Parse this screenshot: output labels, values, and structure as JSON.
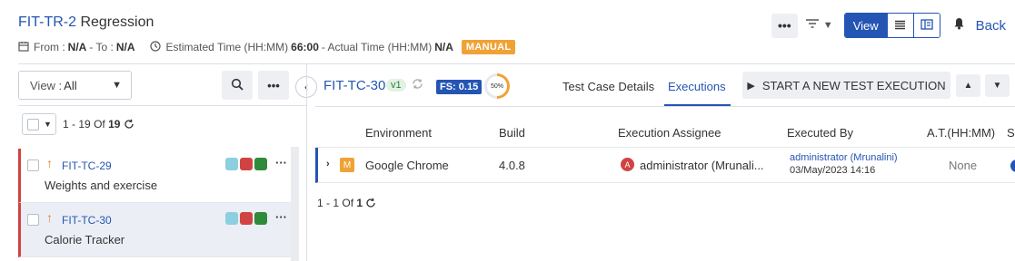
{
  "header": {
    "key": "FIT-TR-2",
    "title": "Regression",
    "from_label": "From :",
    "from_value": "N/A",
    "to_label": "- To :",
    "to_value": "N/A",
    "estimated_label": "Estimated Time (HH:MM)",
    "estimated_value": "66:00",
    "actual_label": "- Actual Time (HH:MM)",
    "actual_value": "N/A",
    "type_badge": "MANUAL",
    "view_label": "View",
    "back_label": "Back"
  },
  "left_panel": {
    "view_select_label": "View :",
    "view_select_value": "All",
    "pager": {
      "from": "1",
      "dash": "-",
      "to": "19",
      "of": "Of",
      "total": "19"
    },
    "test_cases": [
      {
        "id": "FIT-TC-29",
        "name": "Weights and exercise",
        "statuses": [
          "#8ccfe0",
          "#d14343",
          "#2e8b3a"
        ],
        "selected": false
      },
      {
        "id": "FIT-TC-30",
        "name": "Calorie Tracker",
        "statuses": [
          "#8ccfe0",
          "#d14343",
          "#2e8b3a"
        ],
        "selected": true
      }
    ]
  },
  "right_panel": {
    "test_case_id": "FIT-TC-30",
    "version": "v1",
    "fs_badge": "FS: 0.15",
    "progress": "50%",
    "tabs": [
      {
        "label": "Test Case Details",
        "active": false
      },
      {
        "label": "Executions",
        "active": true
      }
    ],
    "start_button": "START A NEW TEST EXECUTION",
    "table": {
      "headers": [
        "Environment",
        "Build",
        "Execution Assignee",
        "Executed By",
        "A.T.(HH:MM)",
        "S"
      ],
      "rows": [
        {
          "type_badge": "M",
          "environment": "Google Chrome",
          "build": "4.0.8",
          "assignee_initial": "A",
          "assignee": "administrator (Mrunali...",
          "executed_by": "administrator (Mrunalini)",
          "executed_date": "03/May/2023 14:16",
          "actual_time": "None"
        }
      ]
    },
    "pager": {
      "from": "1",
      "dash": "-",
      "to": "1",
      "of": "Of",
      "total": "1"
    }
  },
  "colors": {
    "accent": "#2455b4",
    "manual_badge": "#f0a236",
    "failed_border": "#d14343"
  }
}
